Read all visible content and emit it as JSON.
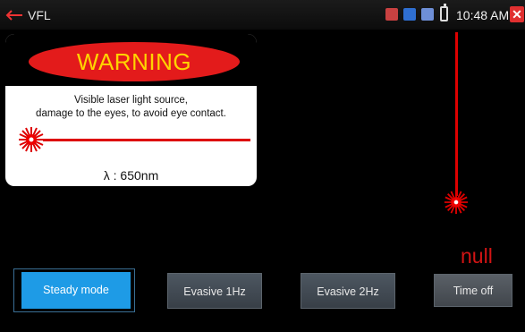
{
  "header": {
    "title": "VFL",
    "time": "10:48 AM",
    "close_glyph": "✕"
  },
  "warning_card": {
    "banner": "WARNING",
    "message_line1": "Visible laser light source,",
    "message_line2": "damage to the eyes, to avoid eye contact.",
    "wavelength": "λ : 650nm"
  },
  "status": {
    "value": "null"
  },
  "modes": {
    "steady": "Steady mode",
    "evasive_1hz": "Evasive 1Hz",
    "evasive_2hz": "Evasive 2Hz",
    "time_off": "Time off",
    "selected": "Steady mode"
  },
  "colors": {
    "accent": "#1e9be6",
    "warning_red": "#e31b1b",
    "warning_text": "#ffd400",
    "laser": "#dd0000"
  },
  "icons": [
    "back-arrow-icon",
    "app-icon",
    "app-icon",
    "app-icon",
    "battery-icon",
    "close-icon",
    "laser-burst-icon"
  ]
}
